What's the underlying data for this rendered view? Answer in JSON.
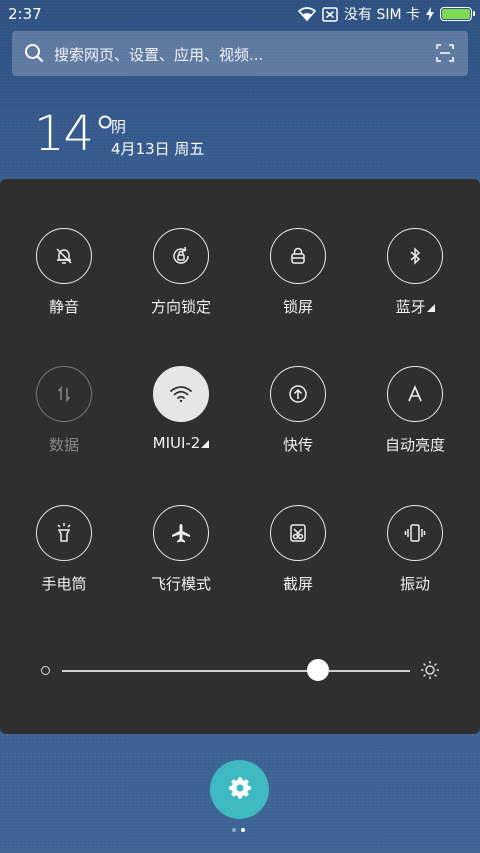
{
  "status_bar": {
    "time": "2:37",
    "carrier": "没有 SIM 卡",
    "battery_level": 1.0,
    "battery_color": "#7ed957"
  },
  "search": {
    "placeholder": "搜索网页、设置、应用、视频...",
    "icon": "search-icon",
    "scan_icon": "scan-icon"
  },
  "weather": {
    "temperature": "14°",
    "condition": "阴",
    "date": "4月13日 周五"
  },
  "quick_settings": {
    "tiles": [
      {
        "id": "mute",
        "label": "静音",
        "icon": "bell-off-icon",
        "active": false,
        "disabled": false
      },
      {
        "id": "rotation-lock",
        "label": "方向锁定",
        "icon": "rotation-lock-icon",
        "active": false,
        "disabled": false
      },
      {
        "id": "lock-screen",
        "label": "锁屏",
        "icon": "lock-icon",
        "active": false,
        "disabled": false
      },
      {
        "id": "bluetooth",
        "label": "蓝牙",
        "icon": "bluetooth-icon",
        "active": false,
        "disabled": false,
        "has_more": true
      },
      {
        "id": "data",
        "label": "数据",
        "icon": "data-arrows-icon",
        "active": false,
        "disabled": true
      },
      {
        "id": "wifi",
        "label": "MIUI-2",
        "icon": "wifi-icon",
        "active": true,
        "disabled": false,
        "has_more": true
      },
      {
        "id": "quick-transfer",
        "label": "快传",
        "icon": "upload-icon",
        "active": false,
        "disabled": false
      },
      {
        "id": "auto-brightness",
        "label": "自动亮度",
        "icon": "letter-a-icon",
        "active": false,
        "disabled": false
      },
      {
        "id": "flashlight",
        "label": "手电筒",
        "icon": "flashlight-icon",
        "active": false,
        "disabled": false
      },
      {
        "id": "airplane",
        "label": "飞行模式",
        "icon": "airplane-icon",
        "active": false,
        "disabled": false
      },
      {
        "id": "screenshot",
        "label": "截屏",
        "icon": "scissors-icon",
        "active": false,
        "disabled": false
      },
      {
        "id": "vibrate",
        "label": "振动",
        "icon": "vibrate-icon",
        "active": false,
        "disabled": false
      }
    ],
    "brightness": {
      "value": 0.735,
      "min_icon": "dim-sun-icon",
      "max_icon": "bright-sun-icon"
    }
  },
  "settings_button": {
    "icon": "gear-icon",
    "color": "#3fb9c2"
  },
  "page_indicator": {
    "count": 2,
    "current": 2
  }
}
